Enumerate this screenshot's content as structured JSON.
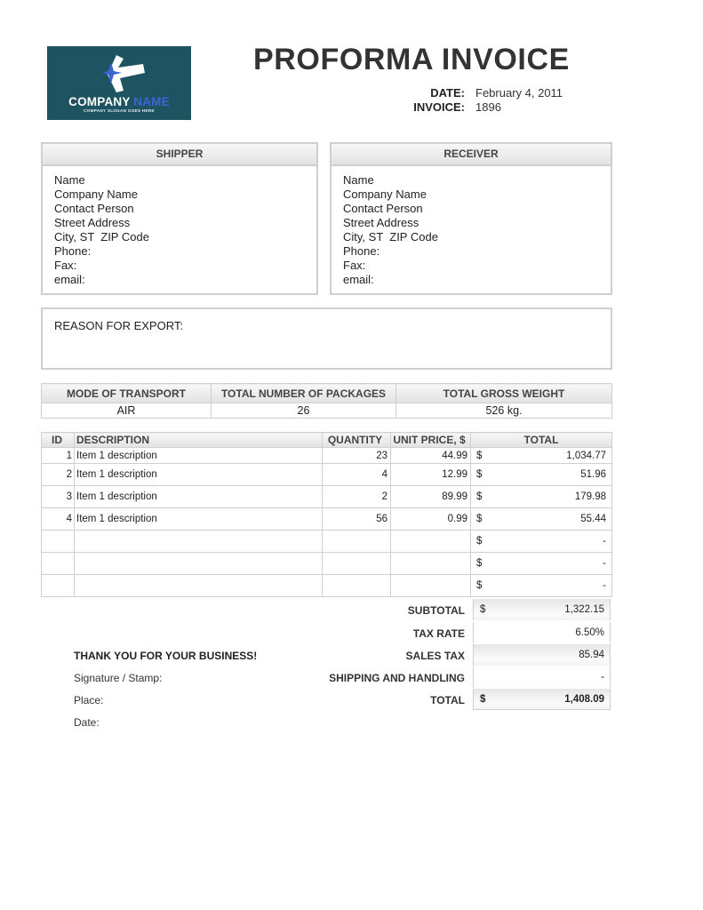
{
  "logo": {
    "company_name_main": "COMPANY",
    "company_name_accent": "NAME",
    "slogan": "COMPANY SLOGAN GOES HERE",
    "background_color": "#1e5361",
    "accent_color": "#3d63d6",
    "icon": "arrow-left-logo-icon"
  },
  "header": {
    "title": "PROFORMA INVOICE",
    "date_label": "DATE:",
    "date_value": "February 4, 2011",
    "invoice_label": "INVOICE:",
    "invoice_value": "1896"
  },
  "shipper": {
    "title": "SHIPPER",
    "lines": [
      "Name",
      "Company Name",
      "Contact Person",
      "Street Address",
      "City, ST  ZIP Code",
      "Phone:",
      "Fax:",
      "email:"
    ]
  },
  "receiver": {
    "title": "RECEIVER",
    "lines": [
      "Name",
      "Company Name",
      "Contact Person",
      "Street Address",
      "City, ST  ZIP Code",
      "Phone:",
      "Fax:",
      "email:"
    ]
  },
  "reason": {
    "label": "REASON FOR EXPORT:"
  },
  "transport": {
    "headers": [
      "MODE OF TRANSPORT",
      "TOTAL NUMBER OF PACKAGES",
      "TOTAL GROSS WEIGHT"
    ],
    "values": [
      "AIR",
      "26",
      "526 kg."
    ]
  },
  "items": {
    "headers": {
      "id": "ID",
      "description": "DESCRIPTION",
      "quantity": "QUANTITY",
      "unit_price": "UNIT PRICE, $",
      "total": "TOTAL"
    },
    "rows": [
      {
        "id": "1",
        "description": "Item 1 description",
        "quantity": "23",
        "unit_price": "44.99",
        "currency": "$",
        "total": "1,034.77"
      },
      {
        "id": "2",
        "description": "Item 1 description",
        "quantity": "4",
        "unit_price": "12.99",
        "currency": "$",
        "total": "51.96"
      },
      {
        "id": "3",
        "description": "Item 1 description",
        "quantity": "2",
        "unit_price": "89.99",
        "currency": "$",
        "total": "179.98"
      },
      {
        "id": "4",
        "description": "Item 1 description",
        "quantity": "56",
        "unit_price": "0.99",
        "currency": "$",
        "total": "55.44"
      },
      {
        "id": "",
        "description": "",
        "quantity": "",
        "unit_price": "",
        "currency": "$",
        "total": "-"
      },
      {
        "id": "",
        "description": "",
        "quantity": "",
        "unit_price": "",
        "currency": "$",
        "total": "-"
      },
      {
        "id": "",
        "description": "",
        "quantity": "",
        "unit_price": "",
        "currency": "$",
        "total": "-"
      }
    ]
  },
  "summary": {
    "subtotal_label": "SUBTOTAL",
    "subtotal_currency": "$",
    "subtotal_value": "1,322.15",
    "tax_rate_label": "TAX RATE",
    "tax_rate_value": "6.50%",
    "sales_tax_label": "SALES TAX",
    "sales_tax_value": "85.94",
    "shipping_label": "SHIPPING AND HANDLING",
    "shipping_value": "-",
    "total_label": "TOTAL",
    "total_currency": "$",
    "total_value": "1,408.09"
  },
  "footer": {
    "thanks": "THANK YOU FOR YOUR BUSINESS!",
    "signature_label": "Signature / Stamp:",
    "place_label": "Place:",
    "date_label": "Date:"
  }
}
